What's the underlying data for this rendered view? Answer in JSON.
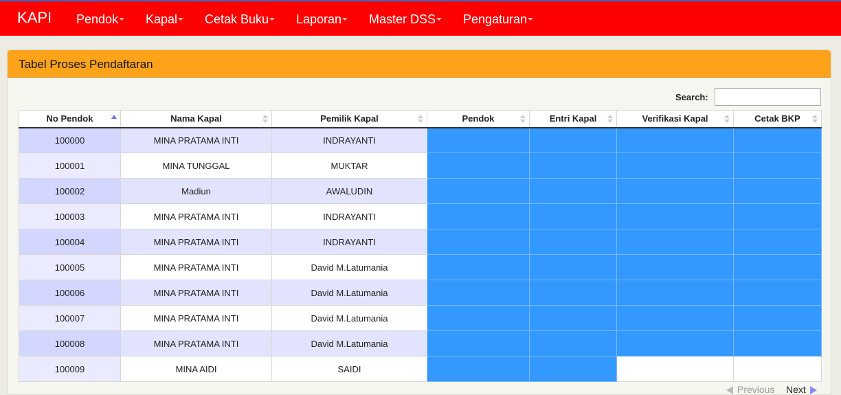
{
  "navbar": {
    "brand": "KAPI",
    "menu": [
      {
        "label": "Pendok"
      },
      {
        "label": "Kapal"
      },
      {
        "label": "Cetak Buku"
      },
      {
        "label": "Laporan"
      },
      {
        "label": "Master DSS"
      },
      {
        "label": "Pengaturan"
      }
    ]
  },
  "panel": {
    "title": "Tabel Proses Pendaftaran",
    "search_label": "Search:",
    "search_value": ""
  },
  "table": {
    "columns": [
      "No Pendok",
      "Nama Kapal",
      "Pemilik Kapal",
      "Pendok",
      "Entri Kapal",
      "Verifikasi Kapal",
      "Cetak BKP"
    ],
    "sorted_column": "No Pendok",
    "status_color": "#3399ff",
    "rows": [
      {
        "no": "100000",
        "nama": "MINA PRATAMA INTI",
        "pemilik": "INDRAYANTI",
        "status": [
          true,
          true,
          true,
          true
        ]
      },
      {
        "no": "100001",
        "nama": "MINA TUNGGAL",
        "pemilik": "MUKTAR",
        "status": [
          true,
          true,
          true,
          true
        ]
      },
      {
        "no": "100002",
        "nama": "Madiun",
        "pemilik": "AWALUDIN",
        "status": [
          true,
          true,
          true,
          true
        ]
      },
      {
        "no": "100003",
        "nama": "MINA PRATAMA INTI",
        "pemilik": "INDRAYANTI",
        "status": [
          true,
          true,
          true,
          true
        ]
      },
      {
        "no": "100004",
        "nama": "MINA PRATAMA INTI",
        "pemilik": "INDRAYANTI",
        "status": [
          true,
          true,
          true,
          true
        ]
      },
      {
        "no": "100005",
        "nama": "MINA PRATAMA INTI",
        "pemilik": "David M.Latumania",
        "status": [
          true,
          true,
          true,
          true
        ]
      },
      {
        "no": "100006",
        "nama": "MINA PRATAMA INTI",
        "pemilik": "David M.Latumania",
        "status": [
          true,
          true,
          true,
          true
        ]
      },
      {
        "no": "100007",
        "nama": "MINA PRATAMA INTI",
        "pemilik": "David M.Latumania",
        "status": [
          true,
          true,
          true,
          true
        ]
      },
      {
        "no": "100008",
        "nama": "MINA PRATAMA INTI",
        "pemilik": "David M.Latumania",
        "status": [
          true,
          true,
          true,
          true
        ]
      },
      {
        "no": "100009",
        "nama": "MINA AIDI",
        "pemilik": "SAIDI",
        "status": [
          true,
          true,
          false,
          false
        ]
      }
    ]
  },
  "pagination": {
    "previous": "Previous",
    "next": "Next"
  },
  "colors": {
    "navbar": "#ff0000",
    "panel_header": "#ffa31a",
    "status_done": "#3399ff"
  }
}
